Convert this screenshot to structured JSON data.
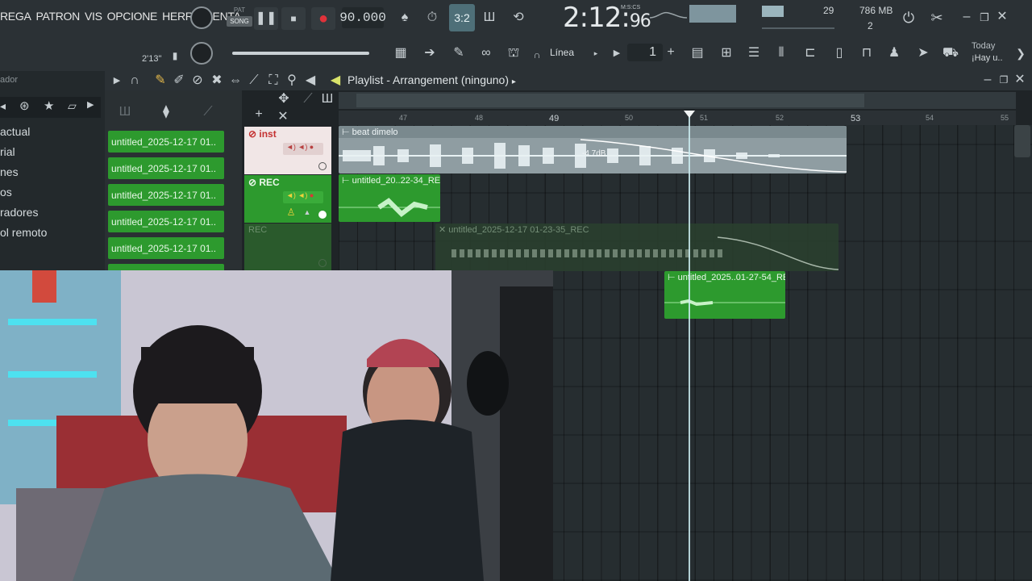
{
  "menu": {
    "items": [
      "REGA",
      "PATRON",
      "VIS",
      "OPCIONE",
      "HERRAMIENTA"
    ]
  },
  "transport": {
    "pat_label": "PAT",
    "song_label": "SONG",
    "tempo": "90.000",
    "song_length": "2'13''"
  },
  "clock": {
    "main": "2:12:",
    "sub": "96",
    "unit": "M:S:CS"
  },
  "system": {
    "voices": "29",
    "memory": "786 MB",
    "cpu_cores": "2"
  },
  "toolbar2": {
    "snap_label": "Línea",
    "step_value": "1",
    "news_label": "Today",
    "news_text": "¡Hay u.."
  },
  "browser": {
    "title": "ador",
    "items": [
      "actual",
      "rial",
      "nes",
      "os",
      "radores",
      "ol remoto"
    ]
  },
  "playlist": {
    "title": "Playlist - Arrangement",
    "breadcrumb": "(ninguno)"
  },
  "patterns": [
    "untitled_2025-12-17 01..",
    "untitled_2025-12-17 01..",
    "untitled_2025-12-17 01..",
    "untitled_2025-12-17 01..",
    "untitled_2025-12-17 01.."
  ],
  "tracks": [
    {
      "name": "inst"
    },
    {
      "name": "REC"
    },
    {
      "name": "REC"
    }
  ],
  "ruler": [
    "47",
    "48",
    "49",
    "50",
    "51",
    "52",
    "53",
    "54",
    "55"
  ],
  "clips": {
    "beat": {
      "title": "beat dimelo",
      "gain": "-4.7dB"
    },
    "rec1": {
      "title": "untitled_20..22-34_REC"
    },
    "rec2": {
      "title": "untitled_2025-12-17 01-23-35_REC"
    },
    "rec3": {
      "title": "untitled_2025..01-27-54_REC"
    }
  },
  "colors": {
    "clip_green": "#2d9a2e",
    "beat_clip": "#8f9da2",
    "accent_cyan": "#6fd0e0"
  }
}
